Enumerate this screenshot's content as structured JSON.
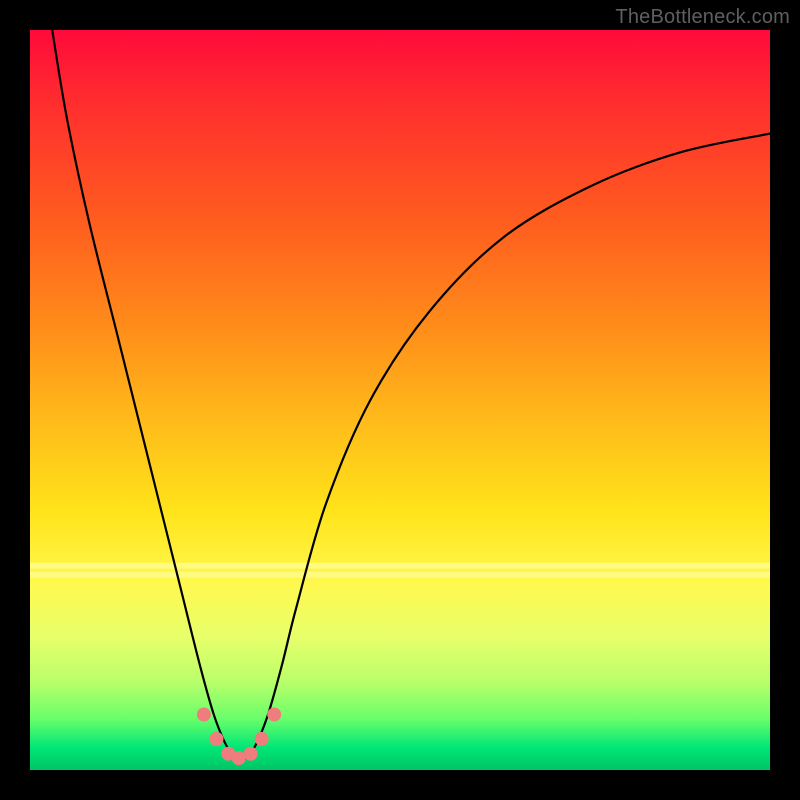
{
  "watermark": "TheBottleneck.com",
  "chart_data": {
    "type": "line",
    "title": "",
    "xlabel": "",
    "ylabel": "",
    "xlim": [
      0,
      100
    ],
    "ylim": [
      0,
      100
    ],
    "series": [
      {
        "name": "curve",
        "color": "#000000",
        "x": [
          3,
          5,
          8,
          12,
          16,
          20,
          23,
          25,
          27,
          28.5,
          30,
          32,
          34,
          36,
          40,
          46,
          54,
          64,
          76,
          88,
          100
        ],
        "y": [
          100,
          88,
          74,
          58,
          42,
          26,
          14,
          7,
          2.5,
          1.5,
          2.5,
          7,
          14,
          22,
          36,
          50,
          62,
          72,
          79,
          83.5,
          86
        ]
      }
    ],
    "markers": {
      "name": "bottom-dots",
      "color": "#ef7d7d",
      "radius_px": 7,
      "x": [
        23.5,
        25.2,
        26.8,
        28.2,
        29.8,
        31.3,
        33.0
      ],
      "y": [
        7.5,
        4.2,
        2.2,
        1.6,
        2.2,
        4.2,
        7.5
      ]
    },
    "gradient_bands": [
      {
        "y_pct": 72.0,
        "color": "rgba(255,255,180,0.55)"
      },
      {
        "y_pct": 73.2,
        "color": "rgba(255,255,200,0.45)"
      }
    ]
  }
}
